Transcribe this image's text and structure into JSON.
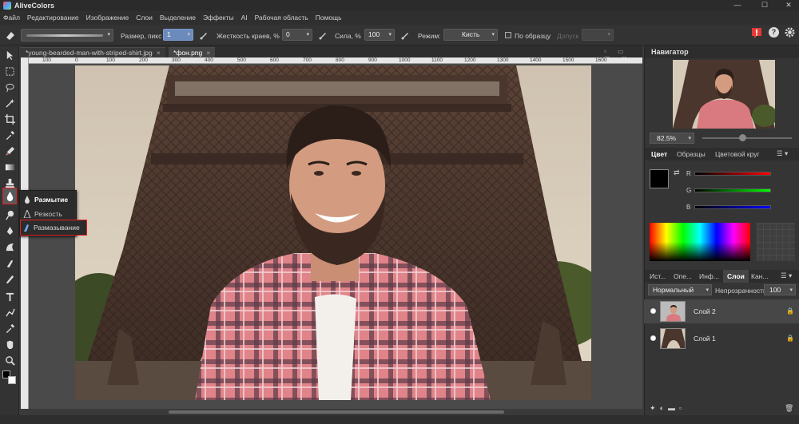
{
  "app": {
    "title": "AliveColors"
  },
  "window_controls": {
    "minimize": "—",
    "maximize": "☐",
    "close": "✕"
  },
  "menu": [
    "Файл",
    "Редактирование",
    "Изображение",
    "Слои",
    "Выделение",
    "Эффекты",
    "AI",
    "Рабочая область",
    "Помощь"
  ],
  "options": {
    "size_label": "Размер, пикс",
    "size_value": "1",
    "hardness_label": "Жесткость краев, %",
    "hardness_value": "0",
    "strength_label": "Сила, %",
    "strength_value": "100",
    "mode_label": "Режим:",
    "mode_value": "Кисть",
    "sample_label": "По образцу",
    "tolerance_label": "Допуск"
  },
  "tabs": [
    {
      "label": "*young-bearded-man-with-striped-shirt.jpg",
      "close": "×"
    },
    {
      "label": "*фон.png",
      "close": "×"
    }
  ],
  "ruler_ticks": [
    "100",
    "0",
    "100",
    "200",
    "300",
    "400",
    "500",
    "600",
    "700",
    "800",
    "900",
    "1000",
    "1100",
    "1200",
    "1300",
    "1400",
    "1500",
    "1600"
  ],
  "flyout": {
    "items": [
      {
        "label": "Размытие",
        "icon": "drop-icon"
      },
      {
        "label": "Резкость",
        "icon": "triangle-icon"
      },
      {
        "label": "Размазывание",
        "icon": "finger-icon"
      }
    ]
  },
  "navigator": {
    "title": "Навигатор",
    "zoom": "82.5%"
  },
  "color_panel": {
    "tabs": [
      "Цвет",
      "Образцы",
      "Цветовой круг"
    ],
    "channels": [
      "R",
      "G",
      "B"
    ],
    "fg": "#000000",
    "bg": "#ffffff"
  },
  "layers_panel": {
    "tabs": [
      "Ист...",
      "Опе...",
      "Инф...",
      "Слои",
      "Кан..."
    ],
    "blend_mode": "Нормальный",
    "opacity_label": "Непрозрачность",
    "opacity_value": "100",
    "layers": [
      {
        "name": "Слой 2",
        "selected": true
      },
      {
        "name": "Слой 1",
        "selected": false
      }
    ]
  }
}
